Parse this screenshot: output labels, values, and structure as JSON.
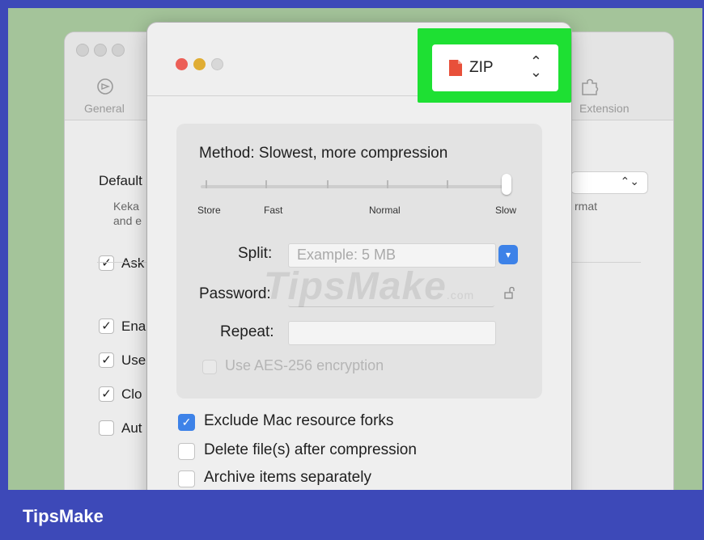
{
  "background_window": {
    "toolbar": {
      "general_label": "General",
      "extension_label": "Extension"
    },
    "default_label": "Default",
    "default_desc_line1": "Keka",
    "default_desc_line2": "and e",
    "format_fragment": "rmat",
    "options": [
      {
        "label": "Ask",
        "checked": true
      },
      {
        "label": "Ena",
        "checked": true
      },
      {
        "label": "Use",
        "checked": true
      },
      {
        "label": "Clo",
        "checked": true
      },
      {
        "label": "Aut",
        "checked": false
      }
    ],
    "select_chevron": "⌃⌄"
  },
  "sheet": {
    "format": {
      "label": "ZIP",
      "icon": "zip-file-icon",
      "chevron": "⇕"
    },
    "method": {
      "label": "Method: Slowest, more compression",
      "slider_labels": [
        "Store",
        "Fast",
        "Normal",
        "Slow"
      ],
      "level": "Slow"
    },
    "split": {
      "label": "Split:",
      "placeholder": "Example: 5 MB"
    },
    "password": {
      "label": "Password:",
      "value": ""
    },
    "repeat": {
      "label": "Repeat:",
      "value": ""
    },
    "aes": {
      "label": "Use AES-256 encryption",
      "checked": false,
      "enabled": false
    },
    "options": [
      {
        "label": "Exclude Mac resource forks",
        "checked": true
      },
      {
        "label": "Delete file(s) after compression",
        "checked": false
      },
      {
        "label": "Archive items separately",
        "checked": false
      }
    ]
  },
  "watermark": {
    "text": "TipsMake",
    "suffix": ".com"
  },
  "brand": {
    "name": "TipsMake"
  },
  "colors": {
    "highlight": "#1ee033",
    "accent_blue": "#3d82e8",
    "brand_bar": "#3d49b8",
    "desktop": "#a4c49a"
  }
}
